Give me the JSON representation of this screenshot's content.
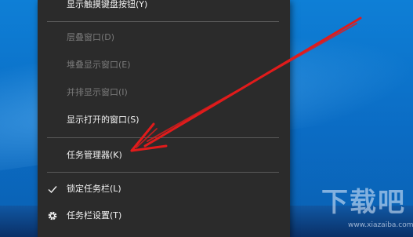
{
  "context_menu": {
    "items": {
      "touch_keyboard": {
        "label": "显示触摸键盘按钮(Y)"
      },
      "cascade": {
        "label": "层叠窗口(D)",
        "disabled": true
      },
      "stacked": {
        "label": "堆叠显示窗口(E)",
        "disabled": true
      },
      "side_by_side": {
        "label": "并排显示窗口(I)",
        "disabled": true
      },
      "show_open": {
        "label": "显示打开的窗口(S)"
      },
      "task_manager": {
        "label": "任务管理器(K)"
      },
      "lock_taskbar": {
        "label": "锁定任务栏(L)",
        "checked": true
      },
      "taskbar_settings": {
        "label": "任务栏设置(T)",
        "icon": "gear-icon"
      }
    }
  },
  "annotation": {
    "arrow_color": "#e11b1b",
    "points_to": "任务管理器(K)"
  },
  "watermark": {
    "brand": "下载吧",
    "url": "www.xiazaiba.com"
  },
  "colors": {
    "menu_bg": "#2b2b2b",
    "menu_text": "#f2f2f2",
    "disabled_text": "#7a7a7a",
    "desktop": "#0b6cc4"
  }
}
